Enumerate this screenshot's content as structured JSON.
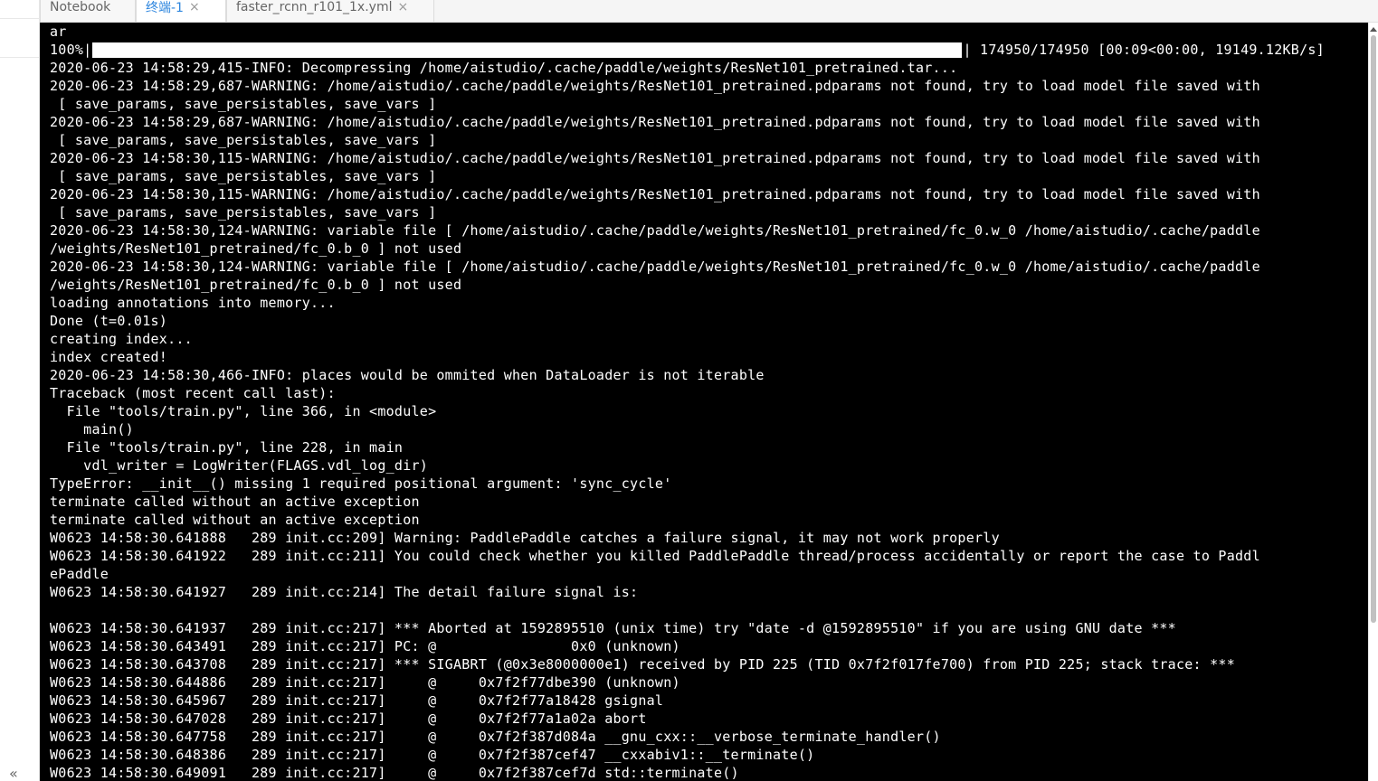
{
  "tabs": [
    {
      "label": "Notebook",
      "active": false,
      "closable": false
    },
    {
      "label": "终端-1",
      "active": true,
      "closable": true
    },
    {
      "label": "faster_rcnn_r101_1x.yml",
      "active": false,
      "closable": true
    }
  ],
  "tab_close_glyph": "×",
  "sidebar": {
    "collapse_icon": "«"
  },
  "terminal": {
    "first_line": "ar",
    "progress": {
      "prefix": "100%|",
      "fraction": 1.0,
      "suffix": "| 174950/174950 [00:09<00:00, 19149.12KB/s]"
    },
    "lines": [
      "2020-06-23 14:58:29,415-INFO: Decompressing /home/aistudio/.cache/paddle/weights/ResNet101_pretrained.tar...",
      "2020-06-23 14:58:29,687-WARNING: /home/aistudio/.cache/paddle/weights/ResNet101_pretrained.pdparams not found, try to load model file saved with",
      " [ save_params, save_persistables, save_vars ]",
      "2020-06-23 14:58:29,687-WARNING: /home/aistudio/.cache/paddle/weights/ResNet101_pretrained.pdparams not found, try to load model file saved with",
      " [ save_params, save_persistables, save_vars ]",
      "2020-06-23 14:58:30,115-WARNING: /home/aistudio/.cache/paddle/weights/ResNet101_pretrained.pdparams not found, try to load model file saved with",
      " [ save_params, save_persistables, save_vars ]",
      "2020-06-23 14:58:30,115-WARNING: /home/aistudio/.cache/paddle/weights/ResNet101_pretrained.pdparams not found, try to load model file saved with",
      " [ save_params, save_persistables, save_vars ]",
      "2020-06-23 14:58:30,124-WARNING: variable file [ /home/aistudio/.cache/paddle/weights/ResNet101_pretrained/fc_0.w_0 /home/aistudio/.cache/paddle",
      "/weights/ResNet101_pretrained/fc_0.b_0 ] not used",
      "2020-06-23 14:58:30,124-WARNING: variable file [ /home/aistudio/.cache/paddle/weights/ResNet101_pretrained/fc_0.w_0 /home/aistudio/.cache/paddle",
      "/weights/ResNet101_pretrained/fc_0.b_0 ] not used",
      "loading annotations into memory...",
      "Done (t=0.01s)",
      "creating index...",
      "index created!",
      "2020-06-23 14:58:30,466-INFO: places would be ommited when DataLoader is not iterable",
      "Traceback (most recent call last):",
      "  File \"tools/train.py\", line 366, in <module>",
      "    main()",
      "  File \"tools/train.py\", line 228, in main",
      "    vdl_writer = LogWriter(FLAGS.vdl_log_dir)",
      "TypeError: __init__() missing 1 required positional argument: 'sync_cycle'",
      "terminate called without an active exception",
      "terminate called without an active exception",
      "W0623 14:58:30.641888   289 init.cc:209] Warning: PaddlePaddle catches a failure signal, it may not work properly",
      "W0623 14:58:30.641922   289 init.cc:211] You could check whether you killed PaddlePaddle thread/process accidentally or report the case to Paddl",
      "ePaddle",
      "W0623 14:58:30.641927   289 init.cc:214] The detail failure signal is:",
      "",
      "W0623 14:58:30.641937   289 init.cc:217] *** Aborted at 1592895510 (unix time) try \"date -d @1592895510\" if you are using GNU date ***",
      "W0623 14:58:30.643491   289 init.cc:217] PC: @                0x0 (unknown)",
      "W0623 14:58:30.643708   289 init.cc:217] *** SIGABRT (@0x3e8000000e1) received by PID 225 (TID 0x7f2f017fe700) from PID 225; stack trace: ***",
      "W0623 14:58:30.644886   289 init.cc:217]     @     0x7f2f77dbe390 (unknown)",
      "W0623 14:58:30.645967   289 init.cc:217]     @     0x7f2f77a18428 gsignal",
      "W0623 14:58:30.647028   289 init.cc:217]     @     0x7f2f77a1a02a abort",
      "W0623 14:58:30.647758   289 init.cc:217]     @     0x7f2f387d084a __gnu_cxx::__verbose_terminate_handler()",
      "W0623 14:58:30.648386   289 init.cc:217]     @     0x7f2f387cef47 __cxxabiv1::__terminate()",
      "W0623 14:58:30.649091   289 init.cc:217]     @     0x7f2f387cef7d std::terminate()"
    ]
  }
}
